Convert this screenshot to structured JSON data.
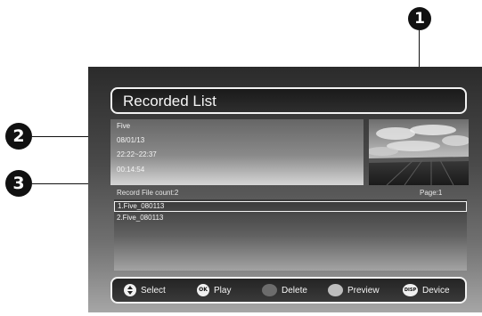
{
  "callouts": [
    "1",
    "2",
    "3"
  ],
  "screen": {
    "title": "Recorded List",
    "info": {
      "name": "Five",
      "date": "08/01/13",
      "time": "22:22~22:37",
      "duration": "00:14:54"
    },
    "file_count": "Record File count:2",
    "page": "Page:1",
    "list": [
      {
        "label": "1.Five_080113",
        "selected": true
      },
      {
        "label": "2.Five_080113",
        "selected": false
      }
    ],
    "hints": {
      "select": "Select",
      "ok_key": "OK",
      "play": "Play",
      "delete": "Delete",
      "preview": "Preview",
      "disp_key": "DISP",
      "device": "Device"
    }
  },
  "colors": {
    "callout": "#111111",
    "text": "#f5f5f5",
    "border": "#f2f2f2"
  }
}
